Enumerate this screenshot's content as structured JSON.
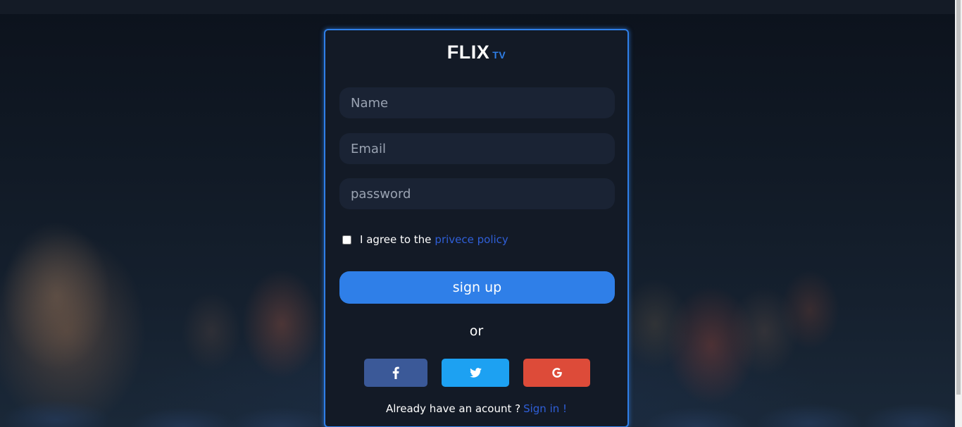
{
  "brand": {
    "name": "FLIX",
    "suffix": "TV"
  },
  "form": {
    "name_placeholder": "Name",
    "email_placeholder": "Email",
    "password_placeholder": "password",
    "agree_text": "I agree to the",
    "policy_link": "privece policy",
    "signup_label": "sign up",
    "or_text": "or"
  },
  "social": {
    "facebook_icon": "facebook-icon",
    "twitter_icon": "twitter-icon",
    "google_icon": "google-icon"
  },
  "footer": {
    "already_text": "Already have an acount ?",
    "signin_link": "Sign in !"
  },
  "colors": {
    "accent": "#2f7fe8",
    "card_bg": "#131a26",
    "field_bg": "#1a2334",
    "facebook": "#3b5998",
    "twitter": "#1da1f2",
    "google": "#dd4b39",
    "link": "#2f5fd8"
  }
}
